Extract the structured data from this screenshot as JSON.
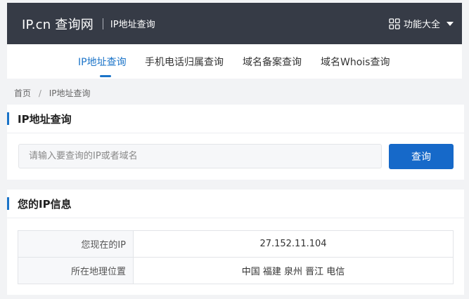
{
  "header": {
    "brand": "IP.cn 查询网",
    "subtitle": "IP地址查询",
    "features_label": "功能大全"
  },
  "nav": {
    "tabs": [
      {
        "label": "IP地址查询",
        "active": true
      },
      {
        "label": "手机电话归属查询",
        "active": false
      },
      {
        "label": "域名备案查询",
        "active": false
      },
      {
        "label": "域名Whois查询",
        "active": false
      }
    ]
  },
  "breadcrumb": {
    "home": "首页",
    "separator": "/",
    "current": "IP地址查询"
  },
  "query_card": {
    "title": "IP地址查询",
    "input_placeholder": "请输入要查询的IP或者域名",
    "input_value": "",
    "button_label": "查询"
  },
  "info_card": {
    "title": "您的IP信息",
    "rows": [
      {
        "key": "您现在的IP",
        "value": "27.152.11.104"
      },
      {
        "key": "所在地理位置",
        "value": "中国 福建 泉州 晋江 电信"
      }
    ]
  },
  "colors": {
    "header_bg": "#363b46",
    "accent": "#1a73c8",
    "button_bg": "#1669c9",
    "page_bg": "#f2f3f5"
  },
  "icons": {
    "features": "grid-icon",
    "features_dropdown": "caret-down-icon"
  }
}
